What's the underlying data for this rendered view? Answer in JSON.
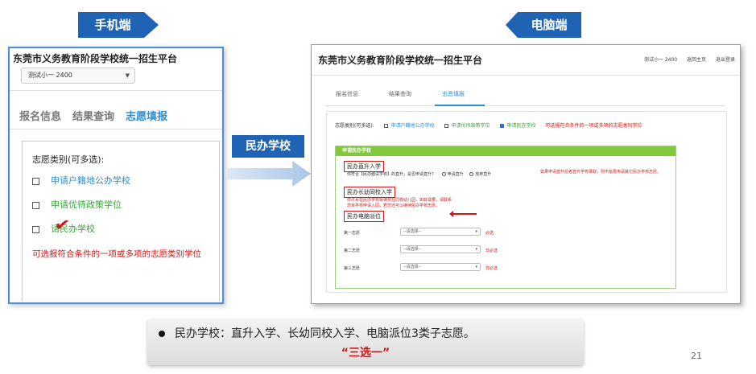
{
  "tags": {
    "mobile": "手机端",
    "pc": "电脑端",
    "center": "民办学校"
  },
  "mobile": {
    "title": "东莞市义务教育阶段学校统一招生平台",
    "user": "测试小一        2400      ",
    "tabs": [
      "报名信息",
      "结果查询",
      "志愿填报"
    ],
    "type_label": "志愿类别(可多选):",
    "options": [
      "申请户籍地公办学校",
      "申请优待政策学位",
      "请民办学校"
    ],
    "note": "可选报符合条件的一项或多项的志愿类别学位"
  },
  "pc": {
    "title": "东莞市义务教育阶段学校统一招生平台",
    "right_items": [
      "测试小一     2400",
      "返回主页",
      "退出登录"
    ],
    "tabs": [
      "报名信息",
      "结果查询",
      "志愿填报"
    ],
    "type_label": "志愿类别(可多选):",
    "type_options": [
      "申请户籍地公办学校",
      "申请优待政策学位",
      "申请民办学校"
    ],
    "type_note": "可选报符合条件的一项或多项的志愿类别学位",
    "section_title": "申请民办学校",
    "box1": "民办直升入学",
    "box1_question": "你符合【民办面试学校】的直升，是否申请直升？",
    "box1_yes": "申请直升",
    "box1_no": "放弃直升",
    "box1_note": "如果申请直升后者直升学校录取，则不能再申请其它民办学校志愿。",
    "box2": "民办长幼同校入学",
    "box2_desc": "你子女在民办学校就读并在同校幼儿园，如有需要，请联系您目学校申请入园，若您还可以继续民办学校志愿。",
    "box3": "民办电脑派位",
    "rows": [
      {
        "label": "第一志愿",
        "placeholder": "--请选择--",
        "req": "必选"
      },
      {
        "label": "第二志愿",
        "placeholder": "--请选择--",
        "req": "非必选"
      },
      {
        "label": "第三志愿",
        "placeholder": "--请选择--",
        "req": "非必选"
      }
    ]
  },
  "bullet": {
    "text": "民办学校：直升入学、长幼同校入学、电脑派位3类子志愿。",
    "emphasis": "“三选一”"
  },
  "page_number": "21",
  "colors": {
    "brand_blue": "#1f63b4",
    "accent_blue": "#2c8fd6",
    "green": "#3aa53a",
    "red": "#d01818"
  }
}
